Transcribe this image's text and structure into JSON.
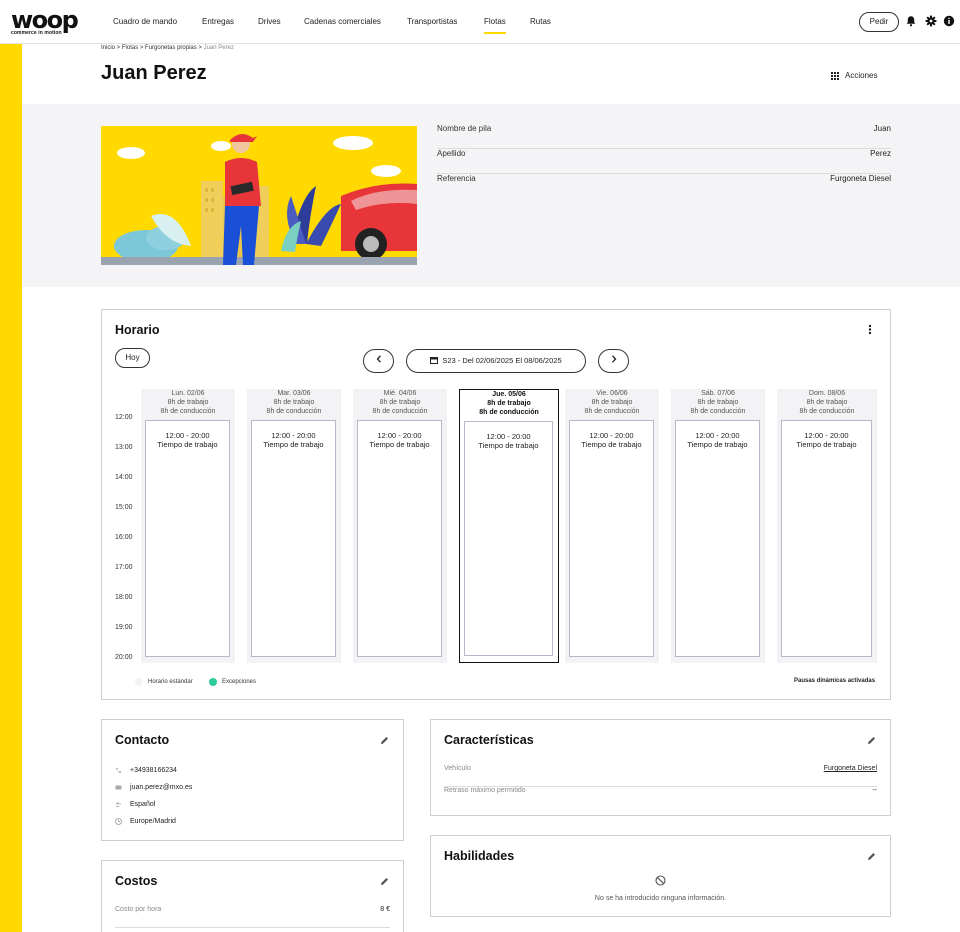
{
  "brand": {
    "name": "woop",
    "tagline": "commerce in motion",
    "accent": "#ffd900"
  },
  "nav": {
    "items": [
      "Cuadro de mando",
      "Entregas",
      "Drives",
      "Cadenas comerciales",
      "Transportistas",
      "Flotas",
      "Rutas"
    ],
    "active": "Flotas",
    "pedir_label": "Pedir",
    "icons": [
      "bell-icon",
      "gear-icon",
      "info-icon"
    ]
  },
  "breadcrumb": {
    "items": [
      "Inicio",
      "Flotas",
      "Furgonetas propias"
    ],
    "current": "Juan Perez"
  },
  "page": {
    "title": "Juan Perez",
    "actions_label": "Acciones"
  },
  "profile": {
    "rows": [
      {
        "label": "Nombre de pila",
        "value": "Juan"
      },
      {
        "label": "Apellido",
        "value": "Perez"
      },
      {
        "label": "Referencia",
        "value": "Furgoneta Diesel"
      }
    ]
  },
  "schedule": {
    "title": "Horario",
    "today_label": "Hoy",
    "week_label": "S23 - Del 02/06/2025 El 08/06/2025",
    "times": [
      "12:00",
      "13:00",
      "14:00",
      "15:00",
      "16:00",
      "17:00",
      "18:00",
      "19:00",
      "20:00"
    ],
    "days": [
      {
        "label": "Lun. 02/06",
        "work": "8h de trabajo",
        "drive": "8h de conducción",
        "slot": "12:00 - 20:00",
        "type": "Tiempo de trabajo",
        "today": false
      },
      {
        "label": "Mar. 03/06",
        "work": "8h de trabajo",
        "drive": "8h de conducción",
        "slot": "12:00 - 20:00",
        "type": "Tiempo de trabajo",
        "today": false
      },
      {
        "label": "Mié. 04/06",
        "work": "8h de trabajo",
        "drive": "8h de conducción",
        "slot": "12:00 - 20:00",
        "type": "Tiempo de trabajo",
        "today": false
      },
      {
        "label": "Jue. 05/06",
        "work": "8h de trabajo",
        "drive": "8h de conducción",
        "slot": "12:00 - 20:00",
        "type": "Tiempo de trabajo",
        "today": true
      },
      {
        "label": "Vie. 06/06",
        "work": "8h de trabajo",
        "drive": "8h de conducción",
        "slot": "12:00 - 20:00",
        "type": "Tiempo de trabajo",
        "today": false
      },
      {
        "label": "Sáb. 07/06",
        "work": "8h de trabajo",
        "drive": "8h de conducción",
        "slot": "12:00 - 20:00",
        "type": "Tiempo de trabajo",
        "today": false
      },
      {
        "label": "Dom. 08/06",
        "work": "8h de trabajo",
        "drive": "8h de conducción",
        "slot": "12:00 - 20:00",
        "type": "Tiempo de trabajo",
        "today": false
      }
    ],
    "legend": [
      {
        "label": "Horario estándar",
        "color": "#f3f3f5"
      },
      {
        "label": "Excepciones",
        "color": "#2ecc9a"
      }
    ],
    "pausas": "Pausas dinámicas activadas"
  },
  "contacto": {
    "title": "Contacto",
    "rows": [
      {
        "icon": "phone-icon",
        "value": "+34938166234"
      },
      {
        "icon": "mail-icon",
        "value": "juan.perez@mxo.es"
      },
      {
        "icon": "users-icon",
        "value": "Español"
      },
      {
        "icon": "clock-icon",
        "value": "Europe/Madrid"
      }
    ]
  },
  "caracteristicas": {
    "title": "Características",
    "rows": [
      {
        "label": "Vehículo",
        "value": "Furgoneta Diesel"
      },
      {
        "label": "Retraso máximo permitido",
        "value": "--"
      }
    ]
  },
  "costos": {
    "title": "Costos",
    "rows": [
      {
        "label": "Costo por hora",
        "value": "8 €"
      }
    ]
  },
  "habilidades": {
    "title": "Habilidades",
    "empty": "No se ha introducido ninguna información."
  }
}
